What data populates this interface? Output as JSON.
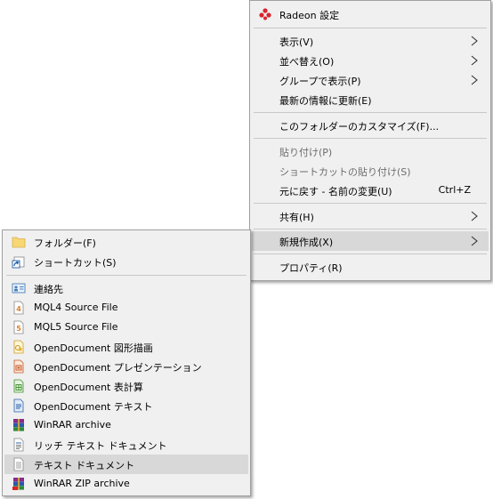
{
  "context_menu": {
    "radeon_label": "Radeon 設定",
    "view_label": "表示(V)",
    "sort_label": "並べ替え(O)",
    "group_label": "グループで表示(P)",
    "refresh_label": "最新の情報に更新(E)",
    "customize_label": "このフォルダーのカスタマイズ(F)...",
    "paste_label": "貼り付け(P)",
    "paste_shortcut_label": "ショートカットの貼り付け(S)",
    "undo_label": "元に戻す - 名前の変更(U)",
    "undo_shortcut": "Ctrl+Z",
    "share_label": "共有(H)",
    "new_label": "新規作成(X)",
    "properties_label": "プロパティ(R)"
  },
  "submenu": {
    "folder_label": "フォルダー(F)",
    "shortcut_label": "ショートカット(S)",
    "contact_label": "連絡先",
    "mql4_label": "MQL4 Source File",
    "mql5_label": "MQL5 Source File",
    "odg_label": "OpenDocument 図形描画",
    "odp_label": "OpenDocument プレゼンテーション",
    "ods_label": "OpenDocument 表計算",
    "odt_label": "OpenDocument テキスト",
    "rar_label": "WinRAR archive",
    "rtf_label": "リッチ テキスト ドキュメント",
    "txt_label": "テキスト ドキュメント",
    "zip_label": "WinRAR ZIP archive"
  },
  "icons": {
    "radeon": "radeon-icon",
    "folder": "folder-icon",
    "shortcut": "shortcut-icon",
    "contact": "contact-card-icon",
    "mql4": "mql4-file-icon",
    "mql5": "mql5-file-icon",
    "odg": "odg-file-icon",
    "odp": "odp-file-icon",
    "ods": "ods-file-icon",
    "odt": "odt-file-icon",
    "rar": "winrar-icon",
    "rtf": "rtf-file-icon",
    "txt": "text-file-icon",
    "zip": "winrar-zip-icon"
  },
  "colors": {
    "menu_bg": "#f0f0f0",
    "highlight": "#d8d8d8",
    "disabled_text": "#6d6d6d",
    "radeon_red": "#d9232d"
  }
}
